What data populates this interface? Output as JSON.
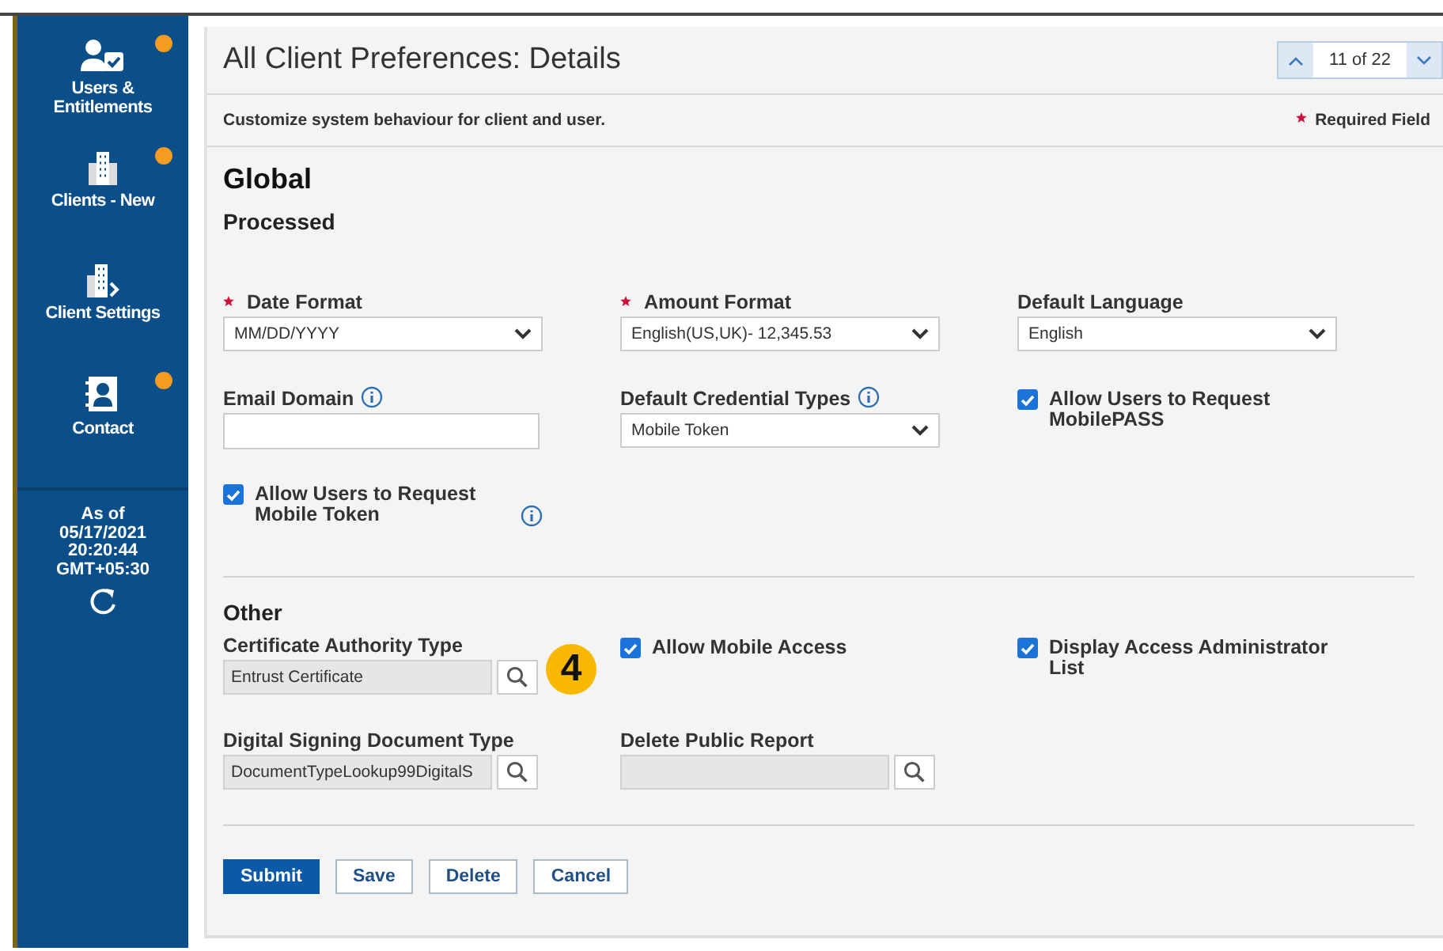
{
  "sidebar": {
    "items": [
      {
        "label": "Users & Entitlements",
        "badge": true
      },
      {
        "label": "Clients - New",
        "badge": true
      },
      {
        "label": "Client Settings",
        "badge": false
      },
      {
        "label": "Contact",
        "badge": true
      }
    ],
    "timestamp": [
      "As of",
      "05/17/2021",
      "20:20:44",
      "GMT+05:30"
    ]
  },
  "header": {
    "title": "All Client Preferences: Details",
    "pager": "11 of 22"
  },
  "subheader": {
    "text": "Customize system behaviour for client and user.",
    "legend": "Required Field"
  },
  "sections": [
    {
      "title": "Global",
      "subtitle": "Processed",
      "fields": [
        {
          "kind": "select",
          "label": "Date Format",
          "required": true,
          "info": false,
          "value": "MM/DD/YYYY"
        },
        {
          "kind": "select",
          "label": "Amount Format",
          "required": true,
          "info": false,
          "value": "English(US,UK)- 12,345.53"
        },
        {
          "kind": "select",
          "label": "Default Language",
          "required": false,
          "info": false,
          "value": "English"
        },
        {
          "kind": "text",
          "label": "Email Domain",
          "required": false,
          "info": true
        },
        {
          "kind": "select",
          "label": "Default Credential Types",
          "required": false,
          "info": true,
          "value": "Mobile Token"
        },
        {
          "kind": "checkbox",
          "label": "Allow Users to Request MobilePASS",
          "checked": true,
          "info": false
        },
        {
          "kind": "checkbox",
          "label": "Allow Users to Request Mobile Token",
          "checked": true,
          "info": true
        }
      ]
    },
    {
      "title": "Other",
      "callout": "4",
      "fields": [
        {
          "kind": "lookup",
          "label": "Certificate Authority Type",
          "required": false,
          "info": false,
          "value": "Entrust Certificate"
        },
        {
          "kind": "checkbox",
          "label": "Allow Mobile Access",
          "checked": true,
          "info": false
        },
        {
          "kind": "checkbox",
          "label": "Display Access Administrator List",
          "checked": true,
          "info": false
        },
        {
          "kind": "lookup",
          "label": "Digital Signing Document Type",
          "required": false,
          "info": false,
          "value": "DocumentTypeLookup99DigitalS"
        },
        {
          "kind": "lookup",
          "label": "Delete Public Report",
          "required": false,
          "info": false
        }
      ]
    }
  ],
  "buttons": [
    {
      "label": "Submit",
      "primary": true
    },
    {
      "label": "Save",
      "primary": false
    },
    {
      "label": "Delete",
      "primary": false
    },
    {
      "label": "Cancel",
      "primary": false
    }
  ]
}
